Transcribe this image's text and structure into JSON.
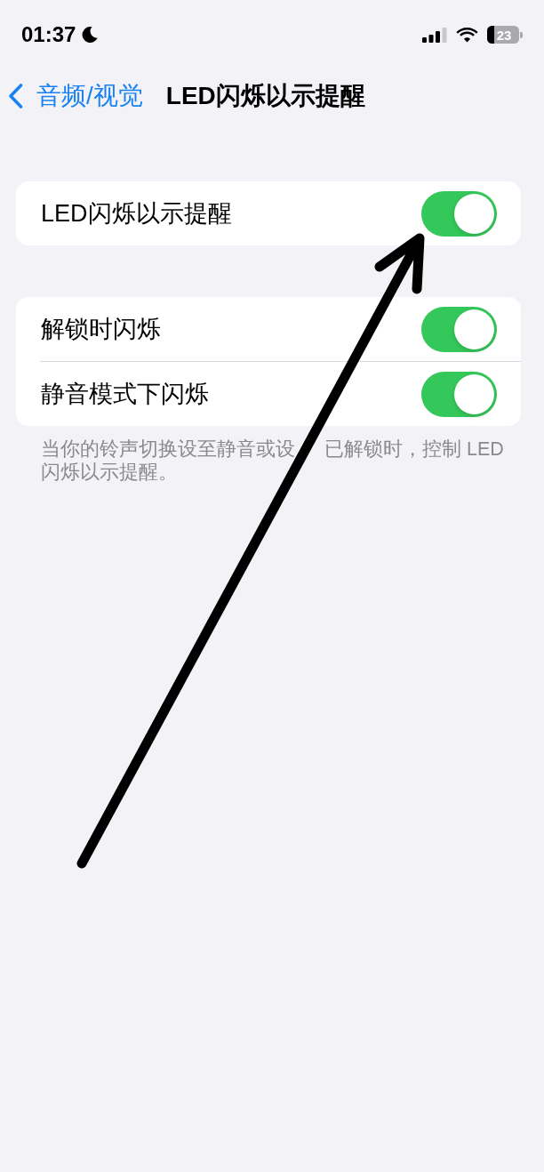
{
  "status_bar": {
    "time": "01:37",
    "battery": "23"
  },
  "nav": {
    "back": "音频/视觉",
    "title": "LED闪烁以示提醒"
  },
  "groups": [
    {
      "rows": [
        {
          "label": "LED闪烁以示提醒",
          "on": true
        }
      ]
    },
    {
      "rows": [
        {
          "label": "解锁时闪烁",
          "on": true
        },
        {
          "label": "静音模式下闪烁",
          "on": true
        }
      ],
      "footer_lines": [
        [
          "当你的铃声切换设至静音或设",
          "已解锁时，控制 LED"
        ],
        [
          "闪烁以示提醒。"
        ]
      ]
    }
  ]
}
